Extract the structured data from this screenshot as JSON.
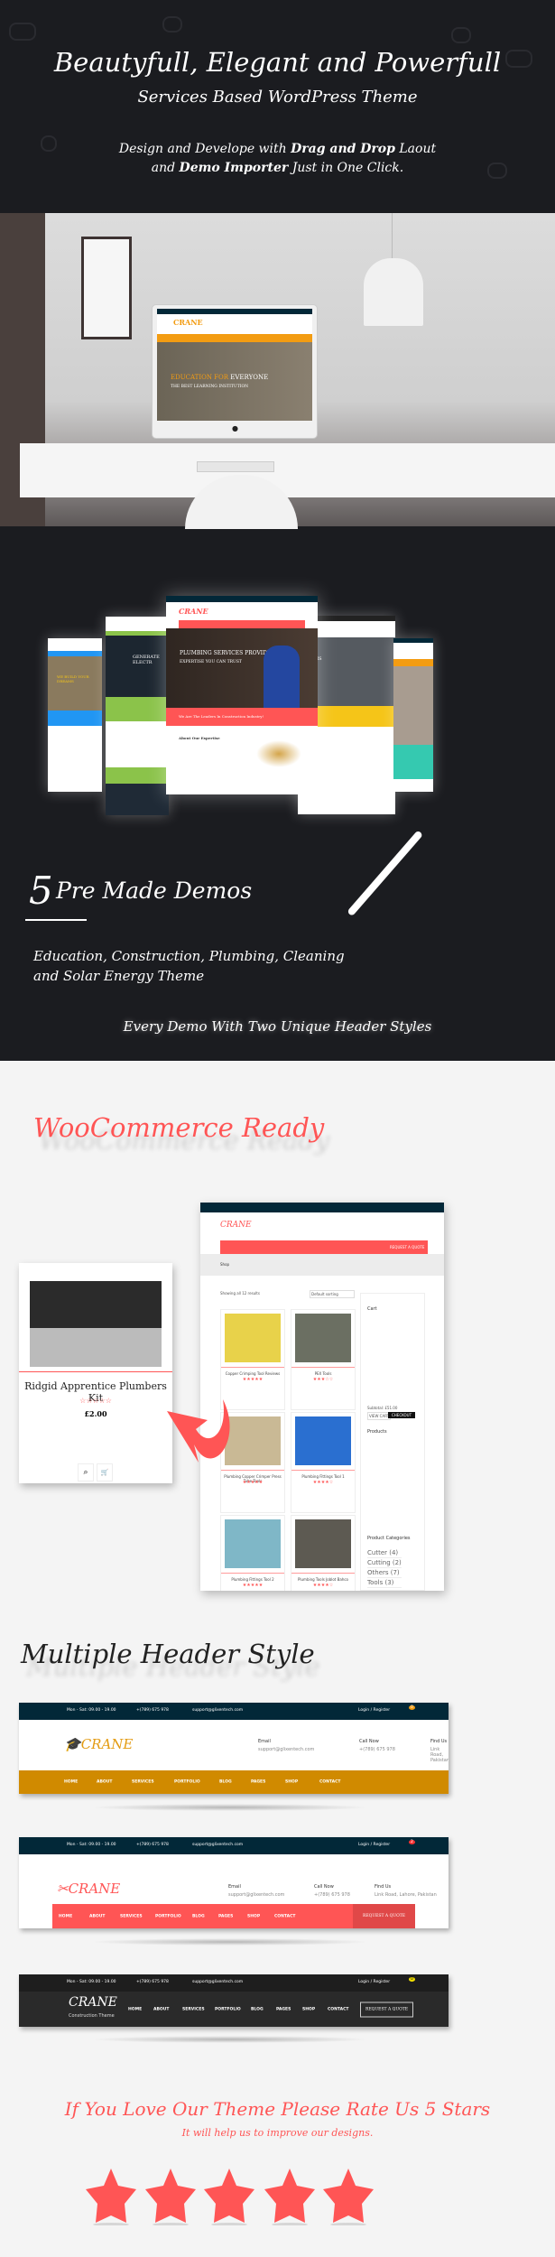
{
  "hero": {
    "title": "Beautyfull, Elegant and Powerfull",
    "subtitle": "Services Based WordPress Theme",
    "desc1_a": "Design and Develope with ",
    "desc1_b": "Drag and Drop",
    "desc1_c": " Laout",
    "desc2_a": "and ",
    "desc2_b": "Demo Importer",
    "desc2_c": " Just in One Click."
  },
  "mockup": {
    "logo": "CRANE",
    "headline_a": "EDUCATION FOR ",
    "headline_b": "EVERYONE",
    "subhead": "THE BEST LEARNING INSTITUTION"
  },
  "demos": {
    "center_heading": "PLUMBING SERVICES PROVIDER",
    "center_sub": "EXPERTISE YOU CAN TRUST",
    "center_banner": "We Are The Leaders In Construction Industry!",
    "center_section": "About Our Expertise",
    "left2_heading": "GENERATE ELECTR",
    "left_heading": "WE BUILD YOUR DREAMS",
    "right_heading": "DREAMS"
  },
  "premade": {
    "number": "5",
    "title": "Pre Made Demos",
    "list1": "Education, Construction, Plumbing, Cleaning",
    "list2": "and Solar Energy Theme",
    "footer": "Every Demo With Two Unique Header Styles"
  },
  "woo": {
    "title": "WooCommerce Ready",
    "card": {
      "name": "Ridgid Apprentice Plumbers Kit",
      "rating": 0,
      "price": "£2.00"
    },
    "shop": {
      "logo": "CRANE",
      "page": "Shop",
      "showing": "Showing all 12 results",
      "sorting": "Default sorting",
      "request": "REQUEST A QUOTE",
      "products": [
        {
          "name": "Copper Crimping Tool Reviews",
          "rating": 5
        },
        {
          "name": "PEX Tools",
          "rating": 3
        },
        {
          "name": "Plumbing Copper Crimper Press Tube Tools",
          "rating": 5
        },
        {
          "name": "Plumbing Fittings Tool 1",
          "rating": 4
        },
        {
          "name": "Plumbing Fittings Tool 2",
          "rating": 5
        },
        {
          "name": "Plumbing Tools Joblot Bahco",
          "rating": 4
        }
      ],
      "sidebar": {
        "cart": "Cart",
        "subtotal": "Subtotal: £51.00",
        "view_cart": "VIEW CART",
        "checkout": "CHECKOUT",
        "products": "Products",
        "categories": "Product Categories",
        "cat_items": [
          "Cutter (4)",
          "Cutting (2)",
          "Others (7)",
          "Tools (3)"
        ]
      }
    }
  },
  "headers": {
    "title": "Multiple Header Style",
    "topbar": {
      "hours": "Mon - Sat: 09.00 - 19.00",
      "phone": "+(789) 675 978",
      "email": "support@glixentech.com",
      "login": "Login / Register"
    },
    "nav": [
      "HOME",
      "ABOUT",
      "SERVICES",
      "PORTFOLIO",
      "BLOG",
      "PAGES",
      "SHOP",
      "CONTACT"
    ],
    "h1": {
      "logo": "CRANE",
      "email_label": "Email",
      "email": "support@glixentech.com",
      "call_label": "Call Now",
      "call": "+(789) 675 978",
      "find_label": "Find Us",
      "find": "Link Road, Pakistan",
      "cart_count": "0",
      "accent": "#d08a00"
    },
    "h2": {
      "logo": "CRANE",
      "email_label": "Email",
      "email": "support@glixentech.com",
      "call_label": "Call Now",
      "call": "+(789) 675 978",
      "find_label": "Find Us",
      "find": "Link Road, Lahore, Pakistan",
      "cart_count": "2",
      "quote": "REQUEST A QUOTE",
      "accent": "#ff5555"
    },
    "h3": {
      "logo": "CRANE",
      "tagline": "Construction Theme",
      "cart_count": "0",
      "quote": "REQUEST A QUOTE",
      "accent": "#f3c300"
    }
  },
  "rate": {
    "title": "If You Love Our Theme Please Rate Us 5 Stars",
    "subtitle": "It will help us to improve our designs.",
    "stars": 5,
    "color": "#ff5555"
  }
}
